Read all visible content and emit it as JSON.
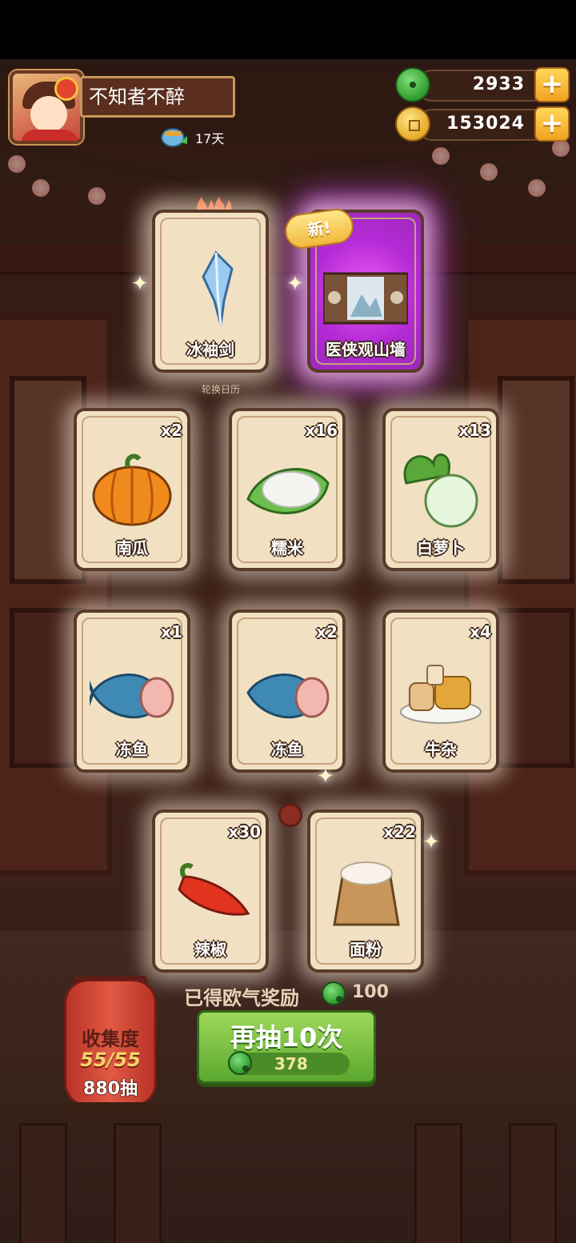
{
  "profile": {
    "name": "不知者不醉",
    "days": "17天"
  },
  "currency": {
    "jade": "2933",
    "coins": "153024"
  },
  "featured_cards": [
    {
      "label": "冰袖剑",
      "badge": ""
    },
    {
      "label": "医侠观山墙",
      "badge": "新!"
    }
  ],
  "rotation_label": "轮换日历",
  "item_cards": [
    {
      "label": "南瓜",
      "count": "x2"
    },
    {
      "label": "糯米",
      "count": "x16"
    },
    {
      "label": "白萝卜",
      "count": "x13"
    },
    {
      "label": "冻鱼",
      "count": "x1"
    },
    {
      "label": "冻鱼",
      "count": "x2"
    },
    {
      "label": "牛杂",
      "count": "x4"
    },
    {
      "label": "辣椒",
      "count": "x30"
    },
    {
      "label": "面粉",
      "count": "x22"
    }
  ],
  "reward": {
    "label": "已得欧气奖励",
    "value": "100"
  },
  "collection": {
    "title": "收集度",
    "progress": "55/55",
    "draws": "880抽"
  },
  "draw_again": {
    "label": "再抽10次",
    "cost": "378"
  },
  "colors": {
    "jade_green": "#2f9a2c",
    "button_green": "#5aa82e",
    "card_bg": "#f1e1c2",
    "purple_glow": "#b42ad6"
  }
}
